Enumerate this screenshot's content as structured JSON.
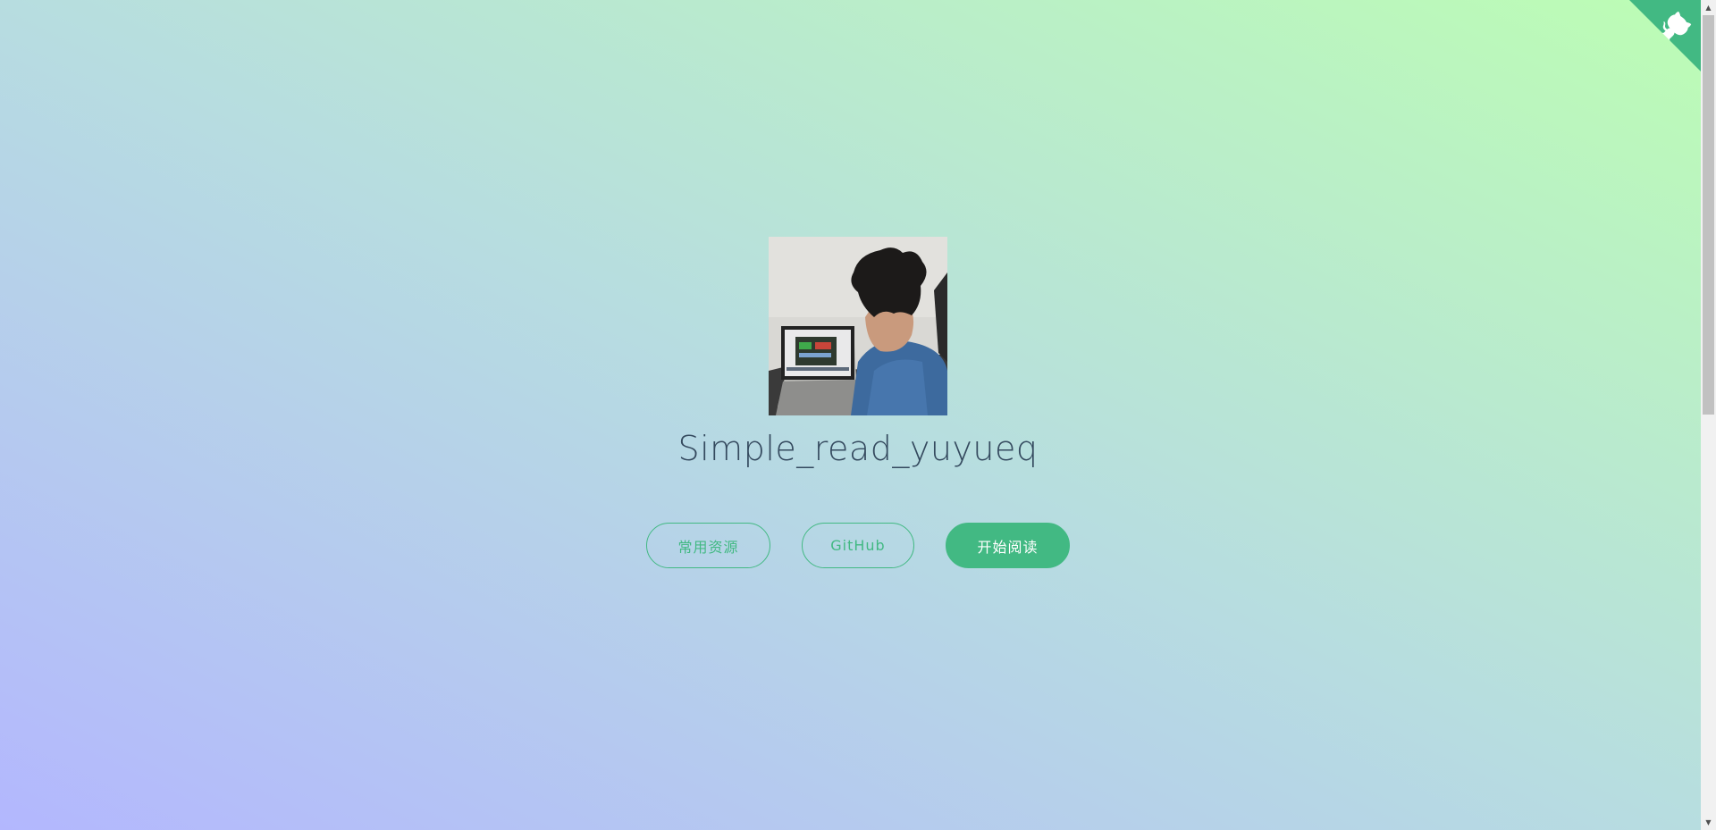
{
  "cover": {
    "title": "Simple_read_yuyueq",
    "avatar_alt": "avatar",
    "buttons": [
      {
        "label": "常用资源"
      },
      {
        "label": "GitHub"
      },
      {
        "label": "开始阅读"
      }
    ]
  },
  "github_corner": {
    "icon": "github-octocat-icon"
  },
  "colors": {
    "accent": "#42b983",
    "title": "#34495e",
    "gradient_top_right": "#bcfdb4",
    "gradient_bottom_left": "#b3b7fe"
  }
}
